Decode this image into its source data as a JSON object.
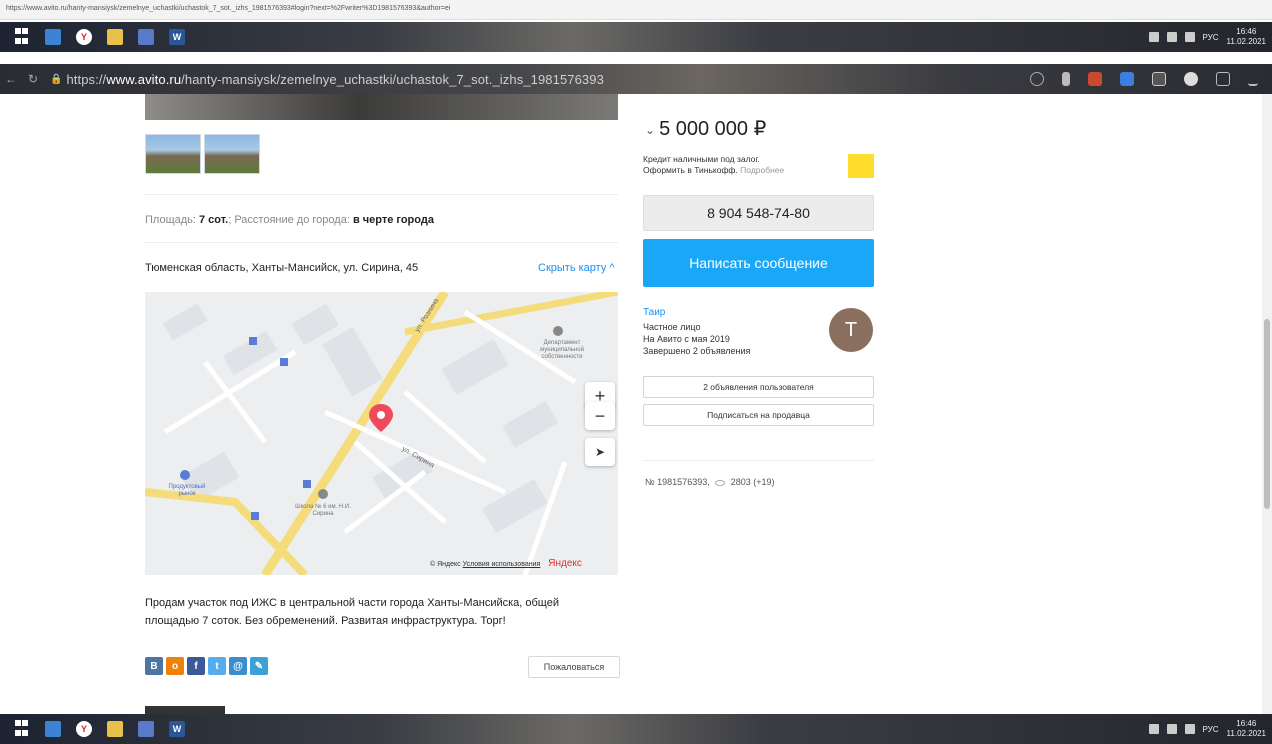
{
  "status_url": "https://www.avito.ru/hanty-mansiysk/zemelnye_uchastki/uchastok_7_sot._izhs_1981576393#login?next=%2Fwriter%3D1981576393&author=ei",
  "taskbar": {
    "lang": "РУС",
    "time": "16:46",
    "date": "11.02.2021",
    "apps": [
      "windows-start-icon",
      "mail-icon",
      "yandex-browser-icon",
      "file-explorer-icon",
      "calculator-icon",
      "word-icon"
    ]
  },
  "browser": {
    "url_prefix": "https://",
    "url_domain": "www.avito.ru",
    "url_path": "/hanty-mansiysk/zemelnye_uchastki/uchastok_7_sot._izhs_1981576393"
  },
  "listing": {
    "params_label_area": "Площадь: ",
    "params_value_area": "7 сот.",
    "params_label_distance": "; Расстояние до города: ",
    "params_value_distance": "в черте города",
    "address": "Тюменская область, Ханты-Мансийск, ул. Сирина, 45",
    "hide_map": "Скрыть карту ^",
    "description": "Продам участок под ИЖС в центральной части города Ханты-Мансийска, общей площадью 7 соток. Без обременений. Развитая инфраструктура. Торг!",
    "complain": "Пожаловаться"
  },
  "map": {
    "zoom_in": "+",
    "zoom_out": "−",
    "copyright": "© Яндекс",
    "terms": "Условия использования",
    "brand": "Яндекс",
    "labels": {
      "street_1": "ул. Рознина",
      "street_2": "ул. Сирина",
      "dept": "Департамент муниципальной собственности",
      "market": "Продуктовый рынок",
      "school": "Школа № 6 им. Н.И. Сирина"
    }
  },
  "sidebar": {
    "price": "5 000 000 ₽",
    "credit_line1": "Кредит наличными под залог.",
    "credit_line2": "Оформить в Тинькофф.",
    "credit_more": "Подробнее",
    "phone": "8 904 548-74-80",
    "message_button": "Написать сообщение",
    "seller_name": "Таир",
    "seller_type": "Частное лицо",
    "seller_since": "На Авито с мая 2019",
    "seller_completed": "Завершено 2 объявления",
    "avatar_letter": "T",
    "ads_button": "2 объявления пользователя",
    "subscribe_button": "Подписаться на продавца",
    "ad_number": "№ 1981576393,",
    "views": "2803 (+19)"
  },
  "colors": {
    "accent": "#1aa7f7",
    "link": "#1a8ff2",
    "avatar": "#8a6f5f"
  }
}
